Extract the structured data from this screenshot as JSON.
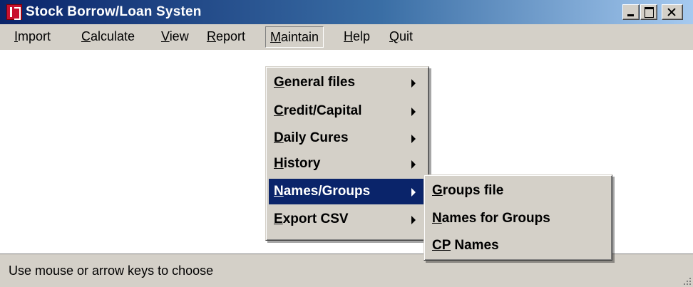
{
  "window": {
    "title": "Stock Borrow/Loan Systen"
  },
  "menubar": {
    "items": [
      {
        "mnemonic": "I",
        "rest": "mport"
      },
      {
        "mnemonic": "C",
        "rest": "alculate"
      },
      {
        "mnemonic": "V",
        "rest": "iew"
      },
      {
        "mnemonic": "R",
        "rest": "eport"
      },
      {
        "mnemonic": "M",
        "rest": "aintain"
      },
      {
        "mnemonic": "H",
        "rest": "elp"
      },
      {
        "mnemonic": "Q",
        "rest": "uit"
      }
    ]
  },
  "maintain_menu": {
    "items": [
      {
        "mnemonic": "G",
        "rest": "eneral files"
      },
      {
        "mnemonic": "C",
        "rest": "redit/Capital"
      },
      {
        "mnemonic": "D",
        "rest": "aily Cures"
      },
      {
        "mnemonic": "H",
        "rest": "istory"
      },
      {
        "mnemonic": "N",
        "rest": "ames/Groups"
      },
      {
        "mnemonic": "E",
        "rest": "xport CSV"
      }
    ]
  },
  "names_groups_submenu": {
    "items": [
      {
        "mnemonic": "G",
        "rest": "roups file"
      },
      {
        "mnemonic": "N",
        "rest": "ames for Groups"
      },
      {
        "mnemonic": "CP",
        "rest": " Names"
      }
    ]
  },
  "statusbar": {
    "text": "Use mouse or arrow keys to choose"
  },
  "colors": {
    "title_gradient_start": "#0a246a",
    "title_gradient_end": "#a6caf0",
    "highlight": "#0a246a",
    "face": "#d4d0c8",
    "icon_red": "#c8102e"
  }
}
